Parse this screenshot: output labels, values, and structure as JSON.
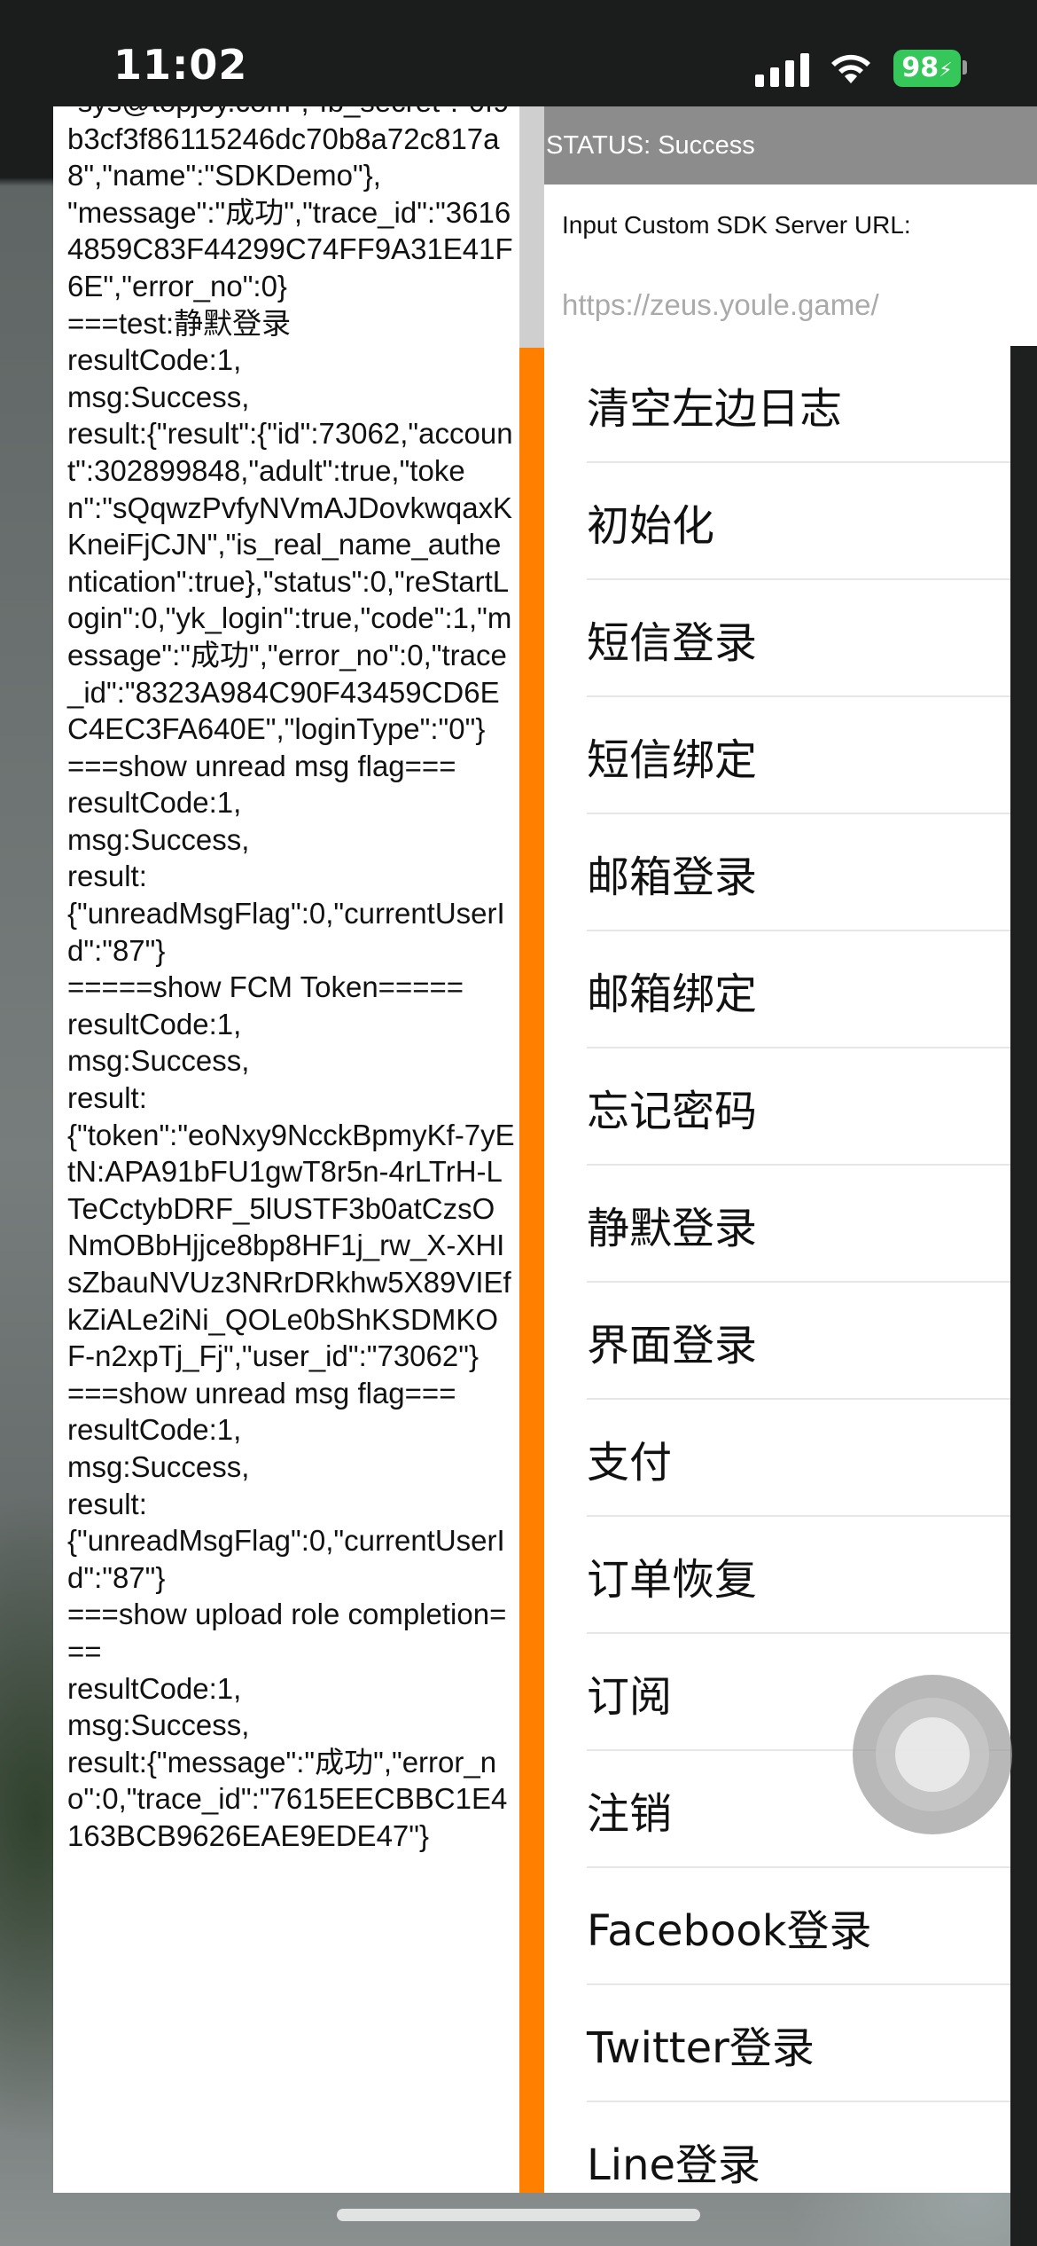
{
  "status_bar": {
    "time": "11:02",
    "battery": "98",
    "icons": [
      "cellular-signal-icon",
      "wifi-icon",
      "battery-charging-icon"
    ],
    "battery_color": "#35c759"
  },
  "log": {
    "text": "\"sys@topjoy.com\",\"fb_secret\":\"0f9b3cf3f86115246dc70b8a72c817a8\",\"name\":\"SDKDemo\"},\n\"message\":\"成功\",\"trace_id\":\"36164859C83F44299C74FF9A31E41F6E\",\"error_no\":0}\n===test:静默登录\nresultCode:1,\nmsg:Success,\nresult:{\"result\":{\"id\":73062,\"account\":302899848,\"adult\":true,\"token\":\"sQqwzPvfyNVmAJDovkwqaxKKneiFjCJN\",\"is_real_name_authentication\":true},\"status\":0,\"reStartLogin\":0,\"yk_login\":true,\"code\":1,\"message\":\"成功\",\"error_no\":0,\"trace_id\":\"8323A984C90F43459CD6EC4EC3FA640E\",\"loginType\":\"0\"}\n===show unread msg flag===\nresultCode:1,\nmsg:Success,\nresult:\n{\"unreadMsgFlag\":0,\"currentUserId\":\"87\"}\n=====show FCM Token=====\nresultCode:1,\nmsg:Success,\nresult:\n{\"token\":\"eoNxy9NcckBpmyKf-7yEtN:APA91bFU1gwT8r5n-4rLTrH-LTeCctybDRF_5lUSTF3b0atCzsONmOBbHjjce8bp8HF1j_rw_X-XHIsZbauNVUz3NRrDRkhw5X89VIEfkZiALe2iNi_QOLe0bShKSDMKOF-n2xpTj_Fj\",\"user_id\":\"73062\"}\n===show unread msg flag===\nresultCode:1,\nmsg:Success,\nresult:\n{\"unreadMsgFlag\":0,\"currentUserId\":\"87\"}\n===show upload role completion===\nresultCode:1,\nmsg:Success,\nresult:{\"message\":\"成功\",\"error_no\":0,\"trace_id\":\"7615EECBBC1E4163BCB9626EAE9EDE47\"}",
    "accent_color": "#ff8000"
  },
  "status_header": "STATUS: Success",
  "server": {
    "label": "Input Custom SDK Server URL:",
    "placeholder": "https://zeus.youle.game/"
  },
  "menu": {
    "items": [
      {
        "label": "清空左边日志"
      },
      {
        "label": "初始化"
      },
      {
        "label": "短信登录"
      },
      {
        "label": "短信绑定"
      },
      {
        "label": "邮箱登录"
      },
      {
        "label": "邮箱绑定"
      },
      {
        "label": "忘记密码"
      },
      {
        "label": "静默登录"
      },
      {
        "label": "界面登录"
      },
      {
        "label": "支付"
      },
      {
        "label": "订单恢复"
      },
      {
        "label": "订阅"
      },
      {
        "label": "注销"
      },
      {
        "label": "Facebook登录"
      },
      {
        "label": "Twitter登录"
      },
      {
        "label": "Line登录"
      }
    ]
  }
}
